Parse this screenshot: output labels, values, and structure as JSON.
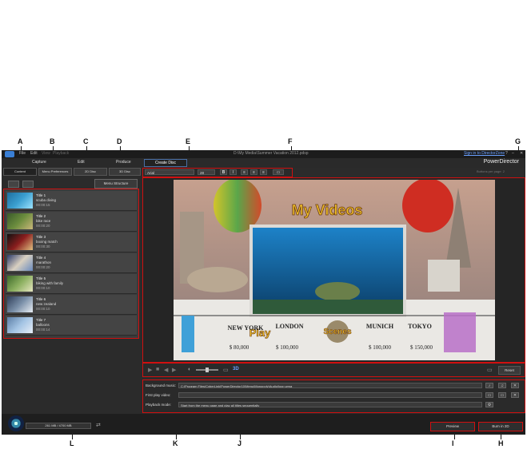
{
  "callouts": {
    "top": [
      "A",
      "B",
      "C",
      "D",
      "E",
      "F",
      "G"
    ],
    "bottom": [
      "L",
      "K",
      "J",
      "I",
      "H"
    ]
  },
  "menu": {
    "items": [
      "File",
      "Edit",
      "View",
      "Playback"
    ],
    "title": "D:\\My Media\\Summer Vacation 2012.pdsp"
  },
  "nav": {
    "capture": "Capture",
    "edit": "Edit",
    "produce": "Produce",
    "create_disc": "Create Disc",
    "sign_in": "Sign in to DirectorZone",
    "brand": "PowerDirector"
  },
  "subtabs": [
    "Content",
    "Menu Preferences",
    "2D Disc",
    "3D Disc"
  ],
  "menu_structure": "Menu Structure",
  "buttons_per_page": "Buttons per page: 2",
  "titles": [
    {
      "name": "Title 1",
      "desc": "scuba diving",
      "time": "00:00:15",
      "palette": [
        "#1e6fa0",
        "#3b9fd0",
        "#9be3ff"
      ]
    },
    {
      "name": "Title 2",
      "desc": "bike race",
      "time": "00:00:20",
      "palette": [
        "#3a5a2a",
        "#6c8d3e",
        "#c9b77a"
      ]
    },
    {
      "name": "Title 3",
      "desc": "boxing match",
      "time": "00:00:30",
      "palette": [
        "#101010",
        "#8b1e1e",
        "#e0c080"
      ]
    },
    {
      "name": "Title 4",
      "desc": "marathon",
      "time": "00:00:20",
      "palette": [
        "#2b3b6b",
        "#d9d0c0",
        "#6a8bbf"
      ]
    },
    {
      "name": "Title 5",
      "desc": "biking with family",
      "time": "00:00:10",
      "palette": [
        "#3d6a2a",
        "#8cb060",
        "#e6e6c0"
      ]
    },
    {
      "name": "Title 6",
      "desc": "new zealand",
      "time": "00:00:10",
      "palette": [
        "#2f3f5a",
        "#7a8fa8",
        "#e7edf3"
      ]
    },
    {
      "name": "Title 7",
      "desc": "balloons",
      "time": "00:00:14",
      "palette": [
        "#5c7ea6",
        "#a4c4e4",
        "#e7eef7"
      ]
    }
  ],
  "toolbar": {
    "font": "Arial",
    "size": "28",
    "bold": "B",
    "italic": "I"
  },
  "preview": {
    "menu_title": "My Videos",
    "play": "Play",
    "scenes": "Scenes",
    "board_cities": [
      "NEW YORK",
      "LONDON",
      "MUNICH",
      "TOKYO"
    ],
    "board_prices": [
      "$ 80,000",
      "$ 100,000",
      "$ 100,000",
      "$ 150,000"
    ]
  },
  "playback": {
    "reset": "Reset"
  },
  "settings": {
    "bg_music_label": "Background music:",
    "bg_music_value": "C:\\Program Files\\CyberLink\\PowerDirector10\\Menu\\Monopoly\\Audio\\loop.wma",
    "first_play_label": "First play video:",
    "first_play_value": "",
    "playback_mode_label": "Playback mode:",
    "playback_mode_value": "Start from the menu page and play all titles sequentially"
  },
  "bottom": {
    "capacity": "261 MB / 4700 MB",
    "preview": "Preview",
    "burn": "Burn in 2D"
  },
  "colors": {
    "highlight": "#d01010",
    "accent": "#4a6fa5"
  }
}
